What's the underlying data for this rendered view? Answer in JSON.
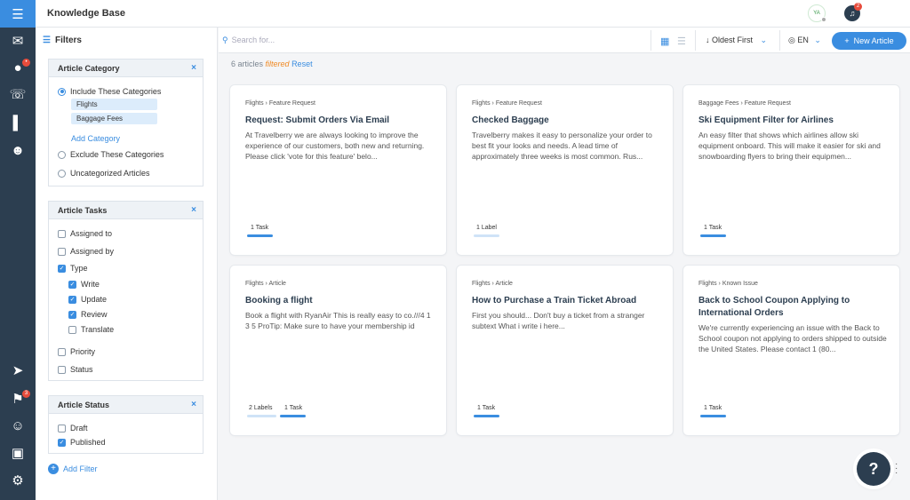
{
  "app": {
    "title": "Knowledge Base"
  },
  "rail": {
    "chat_badge": "",
    "announce_badge": "3"
  },
  "header": {
    "avatar_initials": "YA",
    "notifications_count": "2"
  },
  "filters": {
    "title": "Filters",
    "category": {
      "title": "Article Category",
      "include_label": "Include These Categories",
      "chips": [
        "Flights",
        "Baggage Fees"
      ],
      "add_label": "Add Category",
      "exclude_label": "Exclude These Categories",
      "uncategorized_label": "Uncategorized Articles"
    },
    "tasks": {
      "title": "Article Tasks",
      "assigned_to": "Assigned to",
      "assigned_by": "Assigned by",
      "type": "Type",
      "write": "Write",
      "update": "Update",
      "review": "Review",
      "translate": "Translate",
      "priority": "Priority",
      "status": "Status"
    },
    "status": {
      "title": "Article Status",
      "draft": "Draft",
      "published": "Published"
    },
    "add_filter": "Add Filter"
  },
  "toolbar": {
    "search_placeholder": "Search for...",
    "sort_label": "Oldest First",
    "lang_label": "EN",
    "new_article": "New Article"
  },
  "summary": {
    "count_text": "6 articles",
    "filtered": "filtered",
    "reset": "Reset"
  },
  "cards": [
    {
      "crumb": "Flights › Feature Request",
      "title": "Request: Submit Orders Via Email",
      "body": "At Travelberry we are always looking to improve the experience of our customers, both new and returning. Please click 'vote for this feature' belo...",
      "tags": [
        {
          "label": "1 Task",
          "color": "#3a8de0"
        }
      ]
    },
    {
      "crumb": "Flights › Feature Request",
      "title": "Checked Baggage",
      "body": "Travelberry makes it easy to personalize your order to best fit your looks and needs. A lead time of approximately three weeks is most common. Rus...",
      "tags": [
        {
          "label": "1 Label",
          "color": "#cfe3f7"
        }
      ]
    },
    {
      "crumb": "Baggage Fees › Feature Request",
      "title": "Ski Equipment Filter for Airlines",
      "body": "An easy filter that shows which airlines allow ski equipment onboard. This will make it easier for ski and snowboarding flyers to bring their equipmen...",
      "tags": [
        {
          "label": "1 Task",
          "color": "#3a8de0"
        }
      ]
    },
    {
      "crumb": "Flights › Article",
      "title": "Booking a flight",
      "body": "Book a flight with RyanAir This is really easy to co.///4 1 3 5 ProTip: Make sure to have your membership id",
      "tags": [
        {
          "label": "2 Labels",
          "color": "#cfe3f7"
        },
        {
          "label": "1 Task",
          "color": "#3a8de0"
        }
      ]
    },
    {
      "crumb": "Flights › Article",
      "title": "How to Purchase a Train Ticket Abroad",
      "body": "First you should... Don't buy a ticket from a stranger subtext What i write i here...",
      "tags": [
        {
          "label": "1 Task",
          "color": "#3a8de0"
        }
      ]
    },
    {
      "crumb": "Flights › Known Issue",
      "title": "Back to School Coupon Applying to International Orders",
      "body": "We're currently experiencing an issue with the Back to School coupon not applying to orders shipped to outside the United States. Please contact 1 (80...",
      "tags": [
        {
          "label": "1 Task",
          "color": "#3a8de0"
        }
      ]
    }
  ],
  "help": {
    "label": "?"
  }
}
